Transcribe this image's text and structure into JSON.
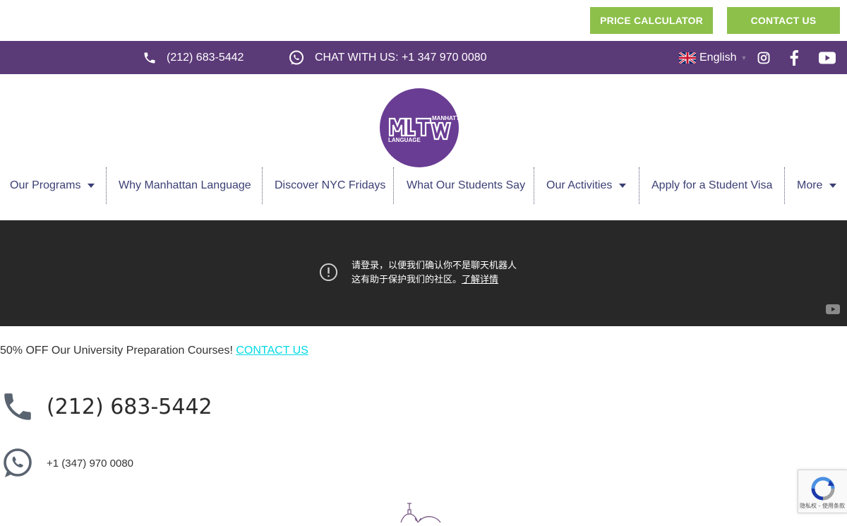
{
  "top_buttons": {
    "price_calculator": "PRICE CALCULATOR",
    "contact_us": "CONTACT US",
    "color": "#8cc04a"
  },
  "info_bar": {
    "background": "#5b3a78",
    "phone": "(212) 683-5442",
    "chat": "CHAT WITH US: +1 347 970 0080",
    "language": "English",
    "social_icons": [
      "instagram-icon",
      "facebook-icon",
      "youtube-icon"
    ]
  },
  "logo": {
    "text_main": "ML",
    "text_right": "MANHATTAN",
    "text_sub": "LANGUAGE",
    "color": "#6a3d94"
  },
  "nav": {
    "items": [
      {
        "label": "Our Programs",
        "dropdown": true
      },
      {
        "label": "Why Manhattan Language",
        "dropdown": false
      },
      {
        "label": "Discover NYC Fridays",
        "dropdown": false
      },
      {
        "label": "What Our Students Say",
        "dropdown": false
      },
      {
        "label": "Our Activities",
        "dropdown": true
      },
      {
        "label": "Apply for a Student Visa",
        "dropdown": false
      },
      {
        "label": "More",
        "dropdown": true
      }
    ]
  },
  "video": {
    "line1": "请登录，以便我们确认你不是聊天机器人",
    "line2": "这有助于保护我们的社区。",
    "learn_more": "了解详情"
  },
  "promo": {
    "text": "50% OFF Our University Preparation Courses! ",
    "cta": "CONTACT US"
  },
  "contact": {
    "phone": "(212) 683-5442",
    "whatsapp": "+1 (347) 970 0080"
  },
  "recaptcha": {
    "footer": "隐私权 - 使用条款"
  }
}
